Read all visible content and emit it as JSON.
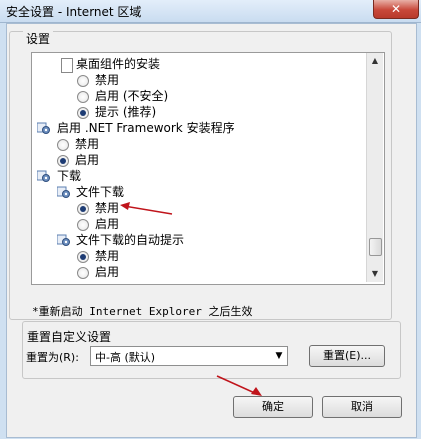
{
  "window": {
    "title": "安全设置 - Internet 区域",
    "close_glyph": "✕"
  },
  "settings_group": {
    "label": "设置"
  },
  "list_items": [
    {
      "text": "桌面组件的安装",
      "kind": "header-page"
    },
    {
      "text": "禁用",
      "kind": "radio",
      "checked": false
    },
    {
      "text": "启用 (不安全)",
      "kind": "radio",
      "checked": false
    },
    {
      "text": "提示 (推荐)",
      "kind": "radio",
      "checked": true
    },
    {
      "text": "启用 .NET Framework 安装程序",
      "kind": "header-gear"
    },
    {
      "text": "禁用",
      "kind": "radio",
      "checked": false
    },
    {
      "text": "启用",
      "kind": "radio",
      "checked": true
    },
    {
      "text": "下载",
      "kind": "header-gear"
    },
    {
      "text": "文件下载",
      "kind": "header-gear-sub"
    },
    {
      "text": "禁用",
      "kind": "radio",
      "checked": true
    },
    {
      "text": "启用",
      "kind": "radio",
      "checked": false
    },
    {
      "text": "文件下载的自动提示",
      "kind": "header-gear-sub"
    },
    {
      "text": "禁用",
      "kind": "radio",
      "checked": true
    },
    {
      "text": "启用",
      "kind": "radio",
      "checked": false
    }
  ],
  "note": "*重新启动 Internet Explorer 之后生效",
  "reset_group": {
    "label": "重置自定义设置",
    "reset_to_label": "重置为(R):",
    "selected_level": "中-高 (默认)",
    "reset_button": "重置(E)..."
  },
  "footer": {
    "ok_button": "确定",
    "cancel_button": "取消"
  },
  "colors": {
    "accent_arrow": "#c0141b",
    "radio_dot": "#1e3c74"
  }
}
